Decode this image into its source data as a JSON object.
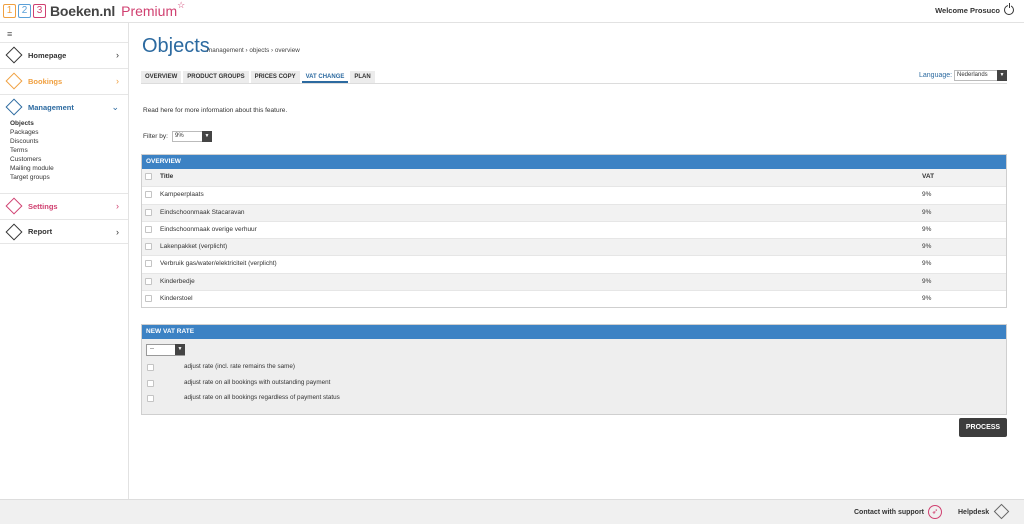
{
  "header": {
    "logo_digits": [
      "1",
      "2",
      "3"
    ],
    "logo_name": "Boeken.nl",
    "logo_premium": "Premium",
    "logo_star": "☆",
    "welcome": "Welcome Prosuco"
  },
  "sidebar": {
    "toggle": "≡",
    "items": [
      {
        "label": "Homepage",
        "chevron": "›",
        "color": "#333333"
      },
      {
        "label": "Bookings",
        "chevron": "›",
        "color": "#f0a040"
      },
      {
        "label": "Management",
        "chevron": "⌄",
        "color": "#2c6aa0"
      },
      {
        "label": "Settings",
        "chevron": "›",
        "color": "#d04070"
      },
      {
        "label": "Report",
        "chevron": "›",
        "color": "#333333"
      }
    ],
    "submenu": [
      "Objects",
      "Packages",
      "Discounts",
      "Terms",
      "Customers",
      "Mailing module",
      "Target groups"
    ]
  },
  "page": {
    "title": "Objects",
    "breadcrumb": "management › objects › overview",
    "tabs": [
      "OVERVIEW",
      "PRODUCT GROUPS",
      "PRICES COPY",
      "VAT CHANGE",
      "PLAN"
    ],
    "active_tab": "VAT CHANGE",
    "language_label": "Language:",
    "language_value": "Nederlands",
    "info_text": "Read here for more information about this feature.",
    "filter_label": "Filter by:",
    "filter_value": "9%"
  },
  "overview": {
    "heading": "OVERVIEW",
    "col_title": "Title",
    "col_vat": "VAT",
    "rows": [
      {
        "title": "Kampeerplaats",
        "vat": "9%"
      },
      {
        "title": "Eindschoonmaak Stacaravan",
        "vat": "9%"
      },
      {
        "title": "Eindschoonmaak overige verhuur",
        "vat": "9%"
      },
      {
        "title": "Lakenpakket (verplicht)",
        "vat": "9%"
      },
      {
        "title": "Verbruik gas/water/elektriciteit (verplicht)",
        "vat": "9%"
      },
      {
        "title": "Kinderbedje",
        "vat": "9%"
      },
      {
        "title": "Kinderstoel",
        "vat": "9%"
      }
    ]
  },
  "new_vat": {
    "heading": "NEW VAT RATE",
    "select_value": "--",
    "options": [
      "adjust rate (incl. rate remains the same)",
      "adjust rate on all bookings with outstanding payment",
      "adjust rate on all bookings regardless of payment status"
    ]
  },
  "process_label": "PROCESS",
  "footer": {
    "contact": "Contact with support",
    "helpdesk": "Helpdesk"
  },
  "colors": {
    "accent": "#2c6aa0",
    "panel_header": "#3c82c4",
    "button": "#3d3d3d"
  }
}
